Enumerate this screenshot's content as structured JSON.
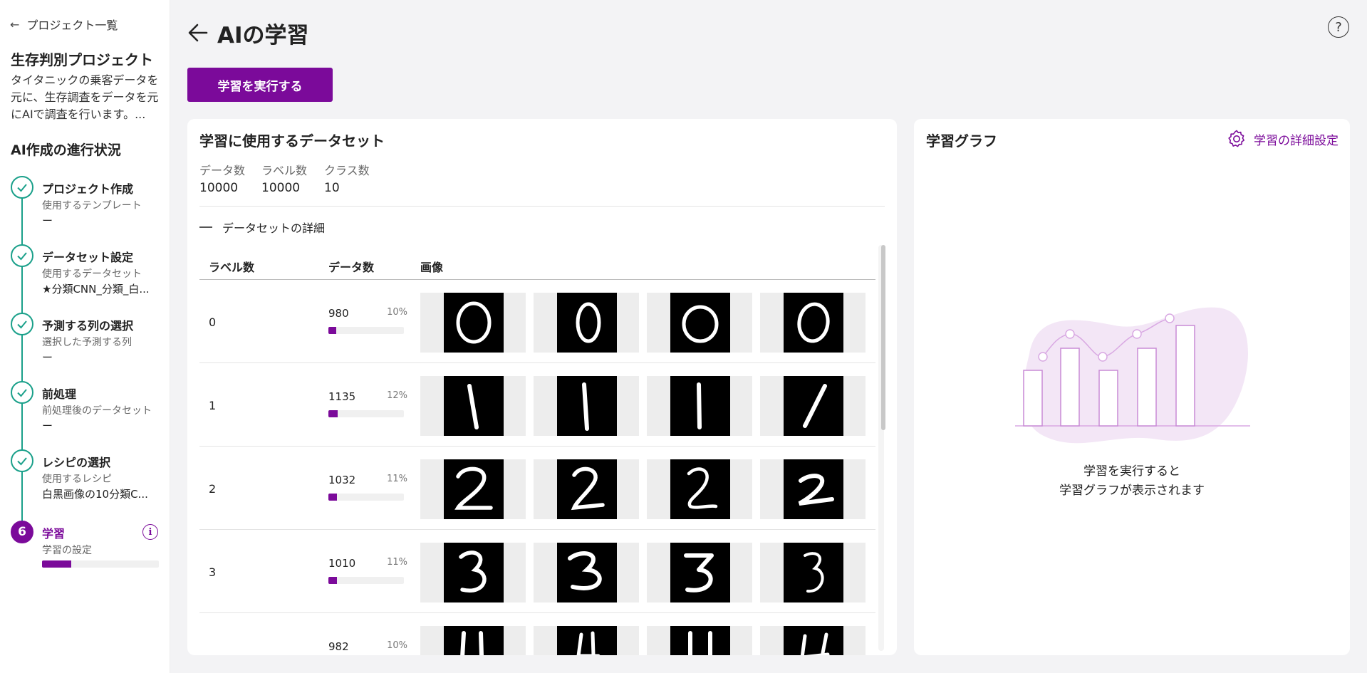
{
  "sidebar": {
    "back_label": "プロジェクト一覧",
    "project_title": "生存判別プロジェクト",
    "project_desc": "タイタニックの乗客データを元に、生存調査をデータを元にAIで調査を行います。...",
    "progress_title": "AI作成の進行状況",
    "steps": [
      {
        "name": "プロジェクト作成",
        "sub": "使用するテンプレート",
        "value": "ー",
        "status": "done"
      },
      {
        "name": "データセット設定",
        "sub": "使用するデータセット",
        "value": "★分類CNN_分類_白...",
        "status": "done"
      },
      {
        "name": "予測する列の選択",
        "sub": "選択した予測する列",
        "value": "ー",
        "status": "done"
      },
      {
        "name": "前処理",
        "sub": "前処理後のデータセット",
        "value": "ー",
        "status": "done"
      },
      {
        "name": "レシピの選択",
        "sub": "使用するレシピ",
        "value": "白黒画像の10分類C...",
        "status": "done"
      },
      {
        "name": "学習",
        "sub": "学習の設定",
        "number": "6",
        "status": "active",
        "progress": 0.25
      }
    ]
  },
  "header": {
    "title": "AIの学習",
    "run_button": "学習を実行する"
  },
  "dataset": {
    "title": "学習に使用するデータセット",
    "stats": [
      {
        "label": "データ数",
        "value": "10000"
      },
      {
        "label": "ラベル数",
        "value": "10000"
      },
      {
        "label": "クラス数",
        "value": "10"
      }
    ],
    "details_label": "データセットの詳細",
    "columns": [
      "ラベル数",
      "データ数",
      "画像"
    ],
    "rows": [
      {
        "label": "0",
        "count": "980",
        "pct": "10%",
        "fraction": 0.1
      },
      {
        "label": "1",
        "count": "1135",
        "pct": "12%",
        "fraction": 0.12
      },
      {
        "label": "2",
        "count": "1032",
        "pct": "11%",
        "fraction": 0.11
      },
      {
        "label": "3",
        "count": "1010",
        "pct": "11%",
        "fraction": 0.11
      },
      {
        "label": "",
        "count": "982",
        "pct": "10%",
        "fraction": 0.1
      }
    ]
  },
  "graph": {
    "title": "学習グラフ",
    "settings_label": "学習の詳細設定",
    "empty_line1": "学習を実行すると",
    "empty_line2": "学習グラフが表示されます"
  },
  "colors": {
    "accent": "#7b0a9a",
    "done": "#1aa08a"
  }
}
